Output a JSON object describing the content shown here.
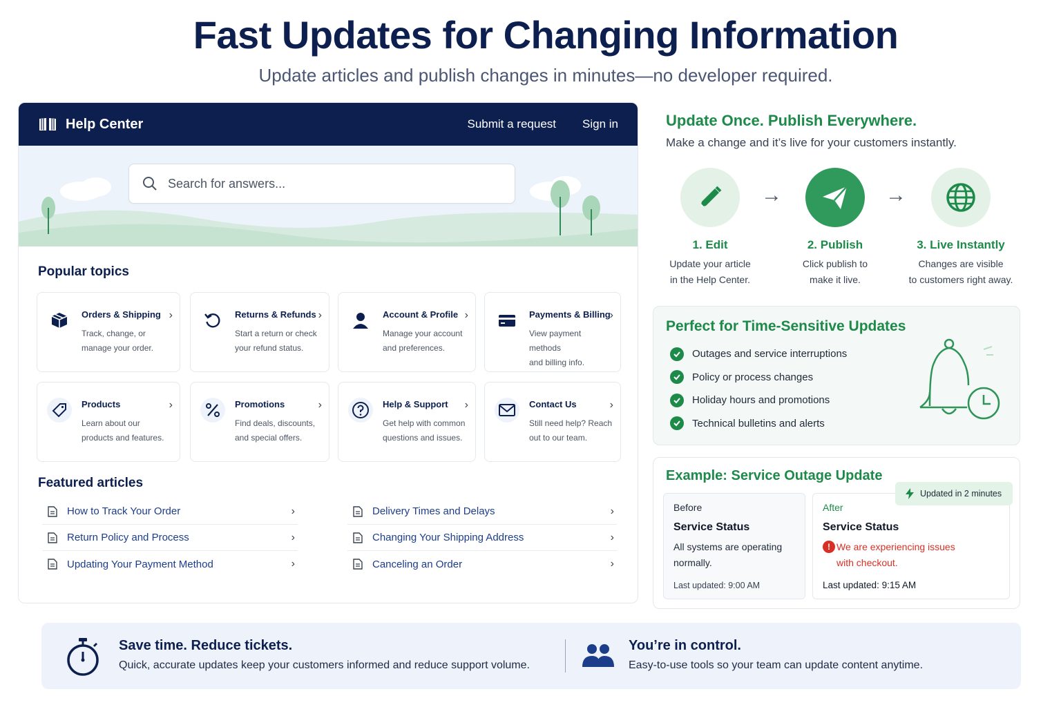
{
  "headline": "Fast Updates for Changing Information",
  "subheadline": "Update articles and publish changes in minutes—no developer required.",
  "help_center": {
    "brand": "Help Center",
    "nav": {
      "submit": "Submit a request",
      "signin": "Sign in"
    },
    "search_placeholder": "Search for answers...",
    "popular_title": "Popular topics",
    "topics": [
      {
        "icon": "box-icon",
        "title": "Orders & Shipping",
        "desc": "Track, change, or\nmanage your order."
      },
      {
        "icon": "return-icon",
        "title": "Returns & Refunds",
        "desc": "Start a return or check\nyour refund status."
      },
      {
        "icon": "user-icon",
        "title": "Account & Profile",
        "desc": "Manage your account\nand preferences."
      },
      {
        "icon": "credit-card-icon",
        "title": "Payments & Billing",
        "desc": "View payment methods\nand billing info."
      },
      {
        "icon": "tag-icon",
        "title": "Products",
        "desc": "Learn about our\nproducts and features."
      },
      {
        "icon": "percent-icon",
        "title": "Promotions",
        "desc": "Find deals, discounts,\nand special offers."
      },
      {
        "icon": "question-icon",
        "title": "Help & Support",
        "desc": "Get help with common\nquestions and issues."
      },
      {
        "icon": "mail-icon",
        "title": "Contact Us",
        "desc": "Still need help? Reach\nout to our team."
      }
    ],
    "featured_title": "Featured articles",
    "articles_left": [
      "How to Track Your Order",
      "Return Policy and Process",
      "Updating Your Payment Method"
    ],
    "articles_right": [
      "Delivery Times and Delays",
      "Changing Your Shipping Address",
      "Canceling an Order"
    ]
  },
  "workflow": {
    "title": "Update Once. Publish Everywhere.",
    "subtitle": "Make a change and it’s live for your customers instantly.",
    "steps": [
      {
        "icon": "pencil-icon",
        "name": "1. Edit",
        "desc": "Update your article\nin the Help Center."
      },
      {
        "icon": "paper-plane-icon",
        "name": "2. Publish",
        "desc": "Click publish to\nmake it live."
      },
      {
        "icon": "globe-icon",
        "name": "3. Live Instantly",
        "desc": "Changes are visible\nto customers right away."
      }
    ]
  },
  "time_sensitive": {
    "title": "Perfect for Time-Sensitive Updates",
    "items": [
      "Outages and service interruptions",
      "Policy or process changes",
      "Holiday hours and promotions",
      "Technical bulletins and alerts"
    ]
  },
  "example": {
    "title": "Example: Service Outage Update",
    "badge": "Updated in 2 minutes",
    "before": {
      "label": "Before",
      "status": "Service Status",
      "message": "All systems are operating\nnormally.",
      "updated": "Last updated: 9:00 AM"
    },
    "after": {
      "label": "After",
      "status": "Service Status",
      "message": "We are experiencing issues\nwith checkout.",
      "updated": "Last updated: 9:15 AM"
    }
  },
  "bottom": {
    "left": {
      "title": "Save time. Reduce tickets.",
      "desc": "Quick, accurate updates keep your customers informed and reduce support volume."
    },
    "right": {
      "title": "You’re in control.",
      "desc": "Easy-to-use tools so your team can update content anytime."
    }
  },
  "colors": {
    "navy": "#0c1f4f",
    "green": "#1e8a4a",
    "link": "#1c3d8a",
    "alert": "#d93025",
    "band": "#eef3fb"
  }
}
